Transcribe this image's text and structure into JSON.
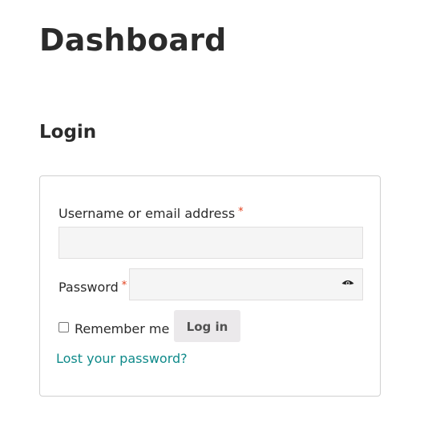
{
  "header": {
    "title": "Dashboard"
  },
  "login": {
    "title": "Login",
    "username_label": "Username or email address",
    "username_value": "",
    "password_label": "Password",
    "password_value": "",
    "required_mark": "*",
    "remember_label": "Remember me",
    "login_button": "Log in",
    "lost_password_link": "Lost your password?"
  },
  "icons": {
    "show_password": "eye-icon"
  },
  "colors": {
    "link": "#0f8a8a",
    "required": "#e2401c",
    "button_bg": "#ebe9eb"
  }
}
